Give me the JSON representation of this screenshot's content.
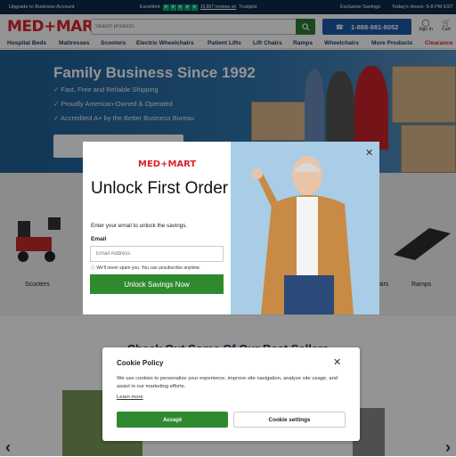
{
  "topbar": {
    "upgrade": "Upgrade to Business Account",
    "excellent": "Excellent",
    "reviews": "10,607 reviews on",
    "trustpilot": "Trustpilot",
    "exclusive": "Exclusive Savings",
    "hours": "Today's Hours: 9-8 PM EST"
  },
  "header": {
    "logo": "MED+MART",
    "search_placeholder": "Search products",
    "phone": "1-888-981-8052",
    "signin": "Sign In",
    "cart": "Cart"
  },
  "nav": {
    "items": [
      "Hospital Beds",
      "Mattresses",
      "Scooters",
      "Electric Wheelchairs",
      "Patient Lifts",
      "Lift Chairs",
      "Ramps",
      "Wheelchairs",
      "More Products",
      "Clearance"
    ]
  },
  "hero": {
    "title": "Family Business Since 1992",
    "bullets": [
      "Fast, Free and Reliable Shipping",
      "Proudly American-Owned & Operated",
      "Accredited A+ by the Better Business Bureau"
    ]
  },
  "categories": {
    "scooters": "Scooters",
    "wheelchairs_partial": "airs",
    "ramps": "Ramps"
  },
  "best": {
    "title": "Check Out Some Of Our Best Sellers"
  },
  "modal": {
    "logo": "MED+MART",
    "title": "Unlock First Order Savings!",
    "subtitle": "Enter your email to unlock the savings.",
    "email_label": "Email",
    "email_placeholder": "Email Address",
    "spam_note": "We'll never spam you. You can unsubscribe anytime.",
    "button": "Unlock Savings Now"
  },
  "cookie": {
    "title": "Cookie Policy",
    "text": "We use cookies to personalize your experience, improve site navigation, analyze site usage, and assist in our marketing efforts.",
    "learn_more": "Learn more",
    "accept": "Accept",
    "settings": "Cookie settings"
  },
  "colors": {
    "brand_red": "#d9232d",
    "navy": "#0e2a4a",
    "green": "#2f8a2f",
    "blue": "#1a5aa8"
  }
}
